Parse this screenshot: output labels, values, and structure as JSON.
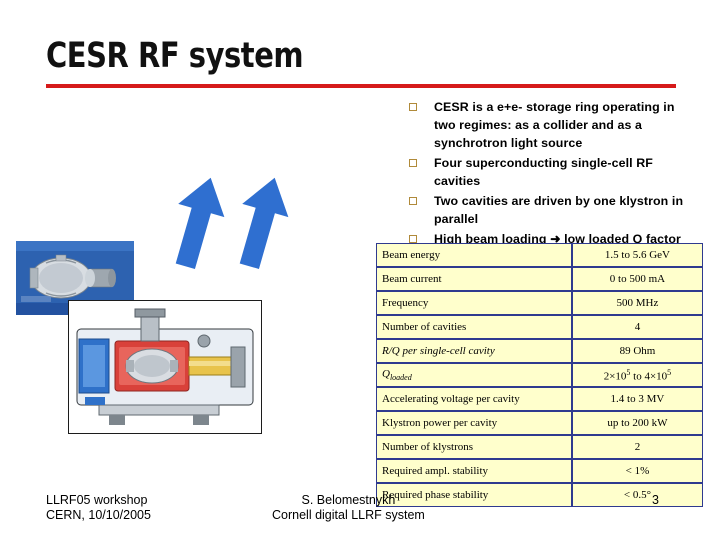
{
  "slide": {
    "title": "CESR RF system",
    "accent_color": "#d61a1a",
    "table_border_color": "#2f3a8f",
    "table_fill_color": "#ffffcc",
    "arrow_color": "#2f6fd0"
  },
  "bullets": [
    "CESR is a e+e- storage ring operating in two regimes: as a collider and as a synchrotron light source",
    "Four superconducting single-cell RF cavities",
    "Two cavities are driven by one klystron in parallel",
    "High beam loading ➜ low loaded Q factor"
  ],
  "table": {
    "rows": [
      {
        "param": "Beam energy",
        "value": "1.5 to 5.6 GeV"
      },
      {
        "param": "Beam current",
        "value": "0 to 500 mA"
      },
      {
        "param": "Frequency",
        "value": "500 MHz"
      },
      {
        "param": "Number of cavities",
        "value": "4"
      },
      {
        "param": "R/Q per single-cell cavity",
        "value": "89 Ohm"
      },
      {
        "param": "Qloaded",
        "value": "2×10⁵ to 4×10⁵"
      },
      {
        "param": "Accelerating voltage per cavity",
        "value": "1.4 to 3 MV"
      },
      {
        "param": "Klystron power per cavity",
        "value": "up to 200 kW"
      },
      {
        "param": "Number of klystrons",
        "value": "2"
      },
      {
        "param": "Required ampl. stability",
        "value": "< 1%"
      },
      {
        "param": "Required phase stability",
        "value": "< 0.5°"
      }
    ]
  },
  "footer": {
    "left_line1": "LLRF05 workshop",
    "left_line2": "CERN, 10/10/2005",
    "center_line1": "S. Belomestnykh",
    "center_line2": "Cornell digital LLRF system",
    "page_number": "3"
  },
  "images": {
    "cavity_photo_name": "superconducting-cavity-photo",
    "cryomodule_drawing_name": "cryomodule-cutaway-drawing"
  }
}
